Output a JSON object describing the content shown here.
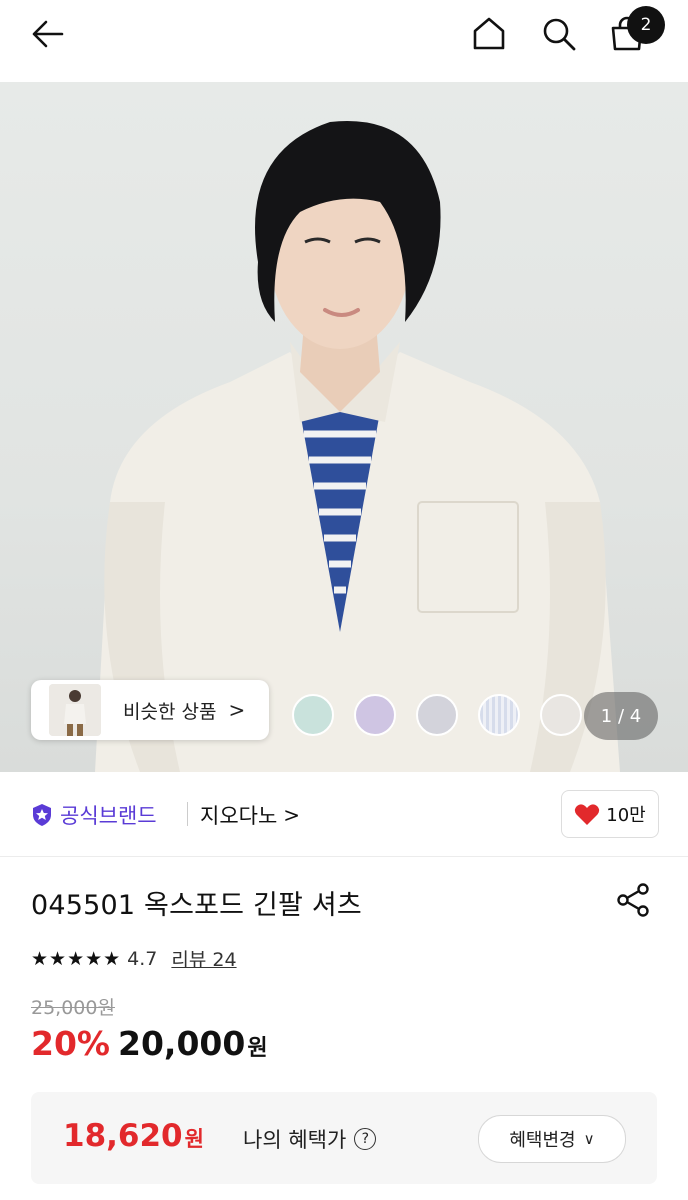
{
  "topbar": {
    "cart_count": "2"
  },
  "hero": {
    "similar_label": "비슷한 상품",
    "similar_chevron": ">",
    "counter": "1 / 4",
    "swatches": [
      "#c9e2dc",
      "#cfc5e3",
      "#d3d3db",
      "#d6dceb",
      "#e9e6e2"
    ]
  },
  "brand": {
    "official_label": "공식브랜드",
    "name": "지오다노",
    "chevron": ">",
    "like_count": "10만"
  },
  "product": {
    "title": "045501 옥스포드 긴팔 셔츠",
    "stars": "★★★★★",
    "rating": "4.7",
    "reviews": "리뷰 24",
    "original_price": "25,000원",
    "discount": "20%",
    "price": "20,000",
    "currency": "원"
  },
  "benefit": {
    "price": "18,620",
    "currency": "원",
    "label": "나의 혜택가",
    "question": "?",
    "change_button": "혜택변경",
    "change_chevron": "∨"
  },
  "colors": {
    "accent_red": "#e2292c",
    "brand_purple": "#5a3bd6"
  }
}
